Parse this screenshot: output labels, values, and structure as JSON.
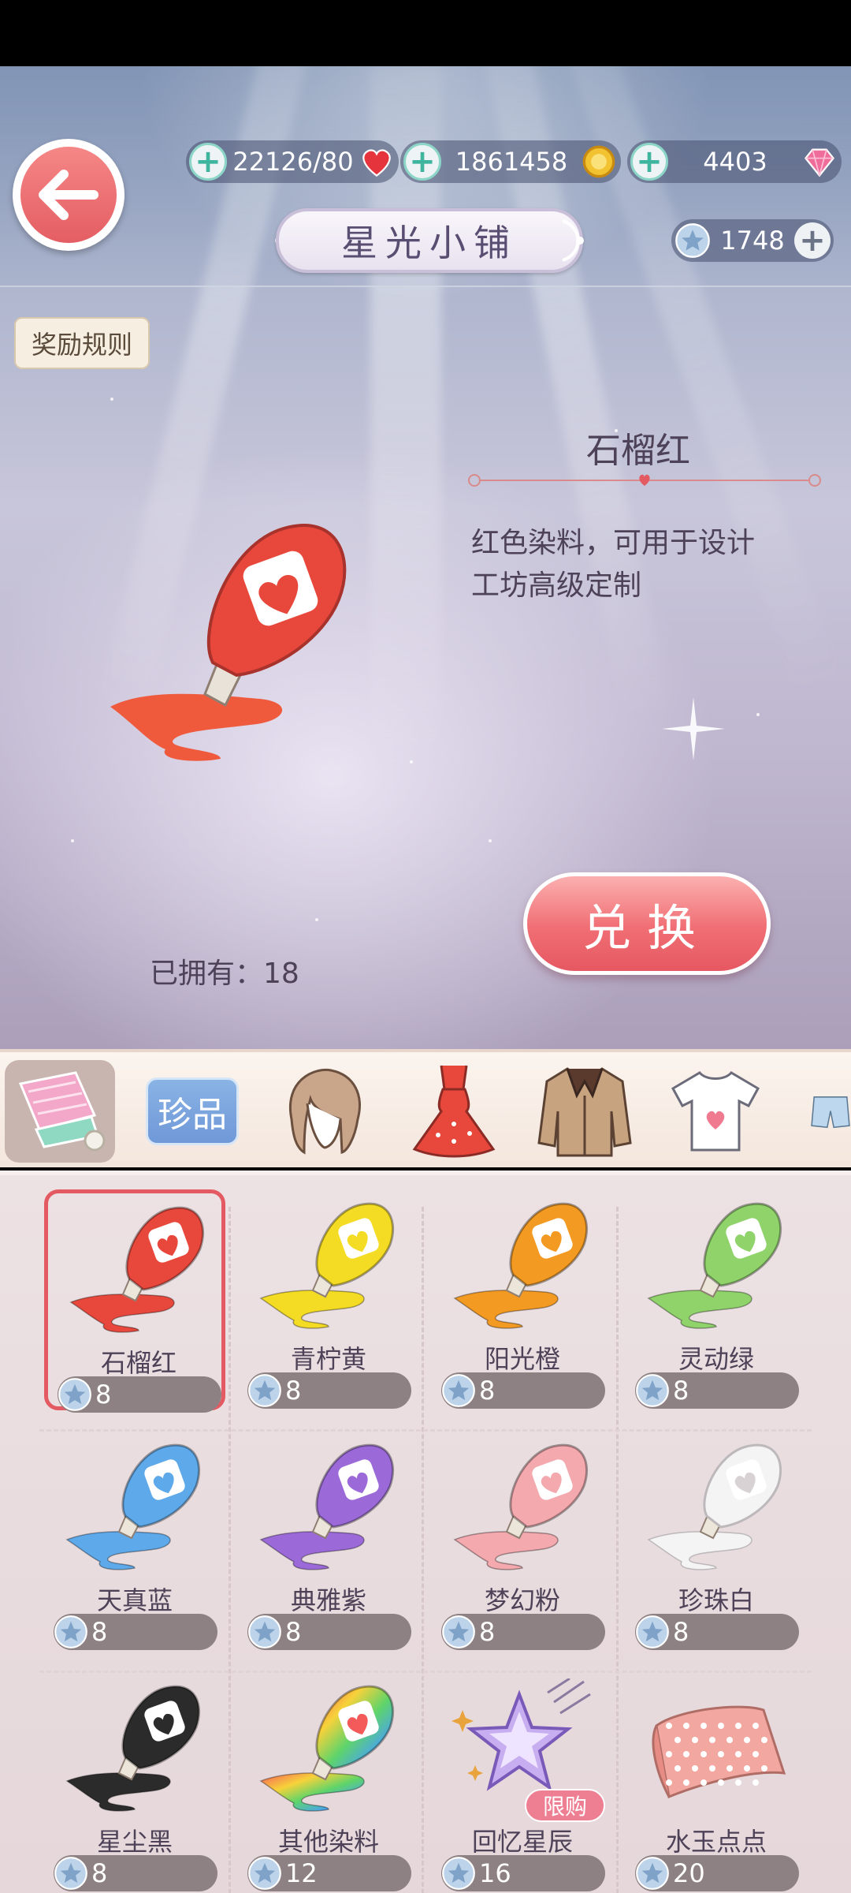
{
  "resources": {
    "stamina": "22126/80",
    "gold": "1861458",
    "diamonds": "4403",
    "star_coins": "1748"
  },
  "shop": {
    "title": "星光小铺",
    "rules_label": "奖励规则"
  },
  "selected_item": {
    "name": "石榴红",
    "description_line1": "红色染料，可用于设计",
    "description_line2": "工坊高级定制",
    "owned_label": "已拥有：",
    "owned_count": "18",
    "redeem_label": "兑换"
  },
  "tabs": [
    {
      "name": "materials",
      "icon": "fabric-icon"
    },
    {
      "name": "treasure",
      "label": "珍品"
    },
    {
      "name": "hair",
      "icon": "hair-icon"
    },
    {
      "name": "dress",
      "icon": "dress-icon"
    },
    {
      "name": "coat",
      "icon": "coat-icon"
    },
    {
      "name": "top",
      "icon": "shirt-icon"
    },
    {
      "name": "bottoms",
      "icon": "pants-icon"
    }
  ],
  "items": [
    {
      "name": "石榴红",
      "price": "8",
      "color": "#e8483c"
    },
    {
      "name": "青柠黄",
      "price": "8",
      "color": "#f4dc24"
    },
    {
      "name": "阳光橙",
      "price": "8",
      "color": "#f39a22"
    },
    {
      "name": "灵动绿",
      "price": "8",
      "color": "#8fd36a"
    },
    {
      "name": "天真蓝",
      "price": "8",
      "color": "#5ea9ea"
    },
    {
      "name": "典雅紫",
      "price": "8",
      "color": "#9b6ad8"
    },
    {
      "name": "梦幻粉",
      "price": "8",
      "color": "#f3a9ae"
    },
    {
      "name": "珍珠白",
      "price": "8",
      "color": "#f4f4f4"
    },
    {
      "name": "星尘黑",
      "price": "8",
      "color": "#2b2b2b"
    },
    {
      "name": "其他染料",
      "price": "12",
      "color": "rainbow"
    },
    {
      "name": "回忆星辰",
      "price": "16",
      "badge": "限购"
    },
    {
      "name": "水玉点点",
      "price": "20",
      "color": "#f2a8a0"
    }
  ]
}
